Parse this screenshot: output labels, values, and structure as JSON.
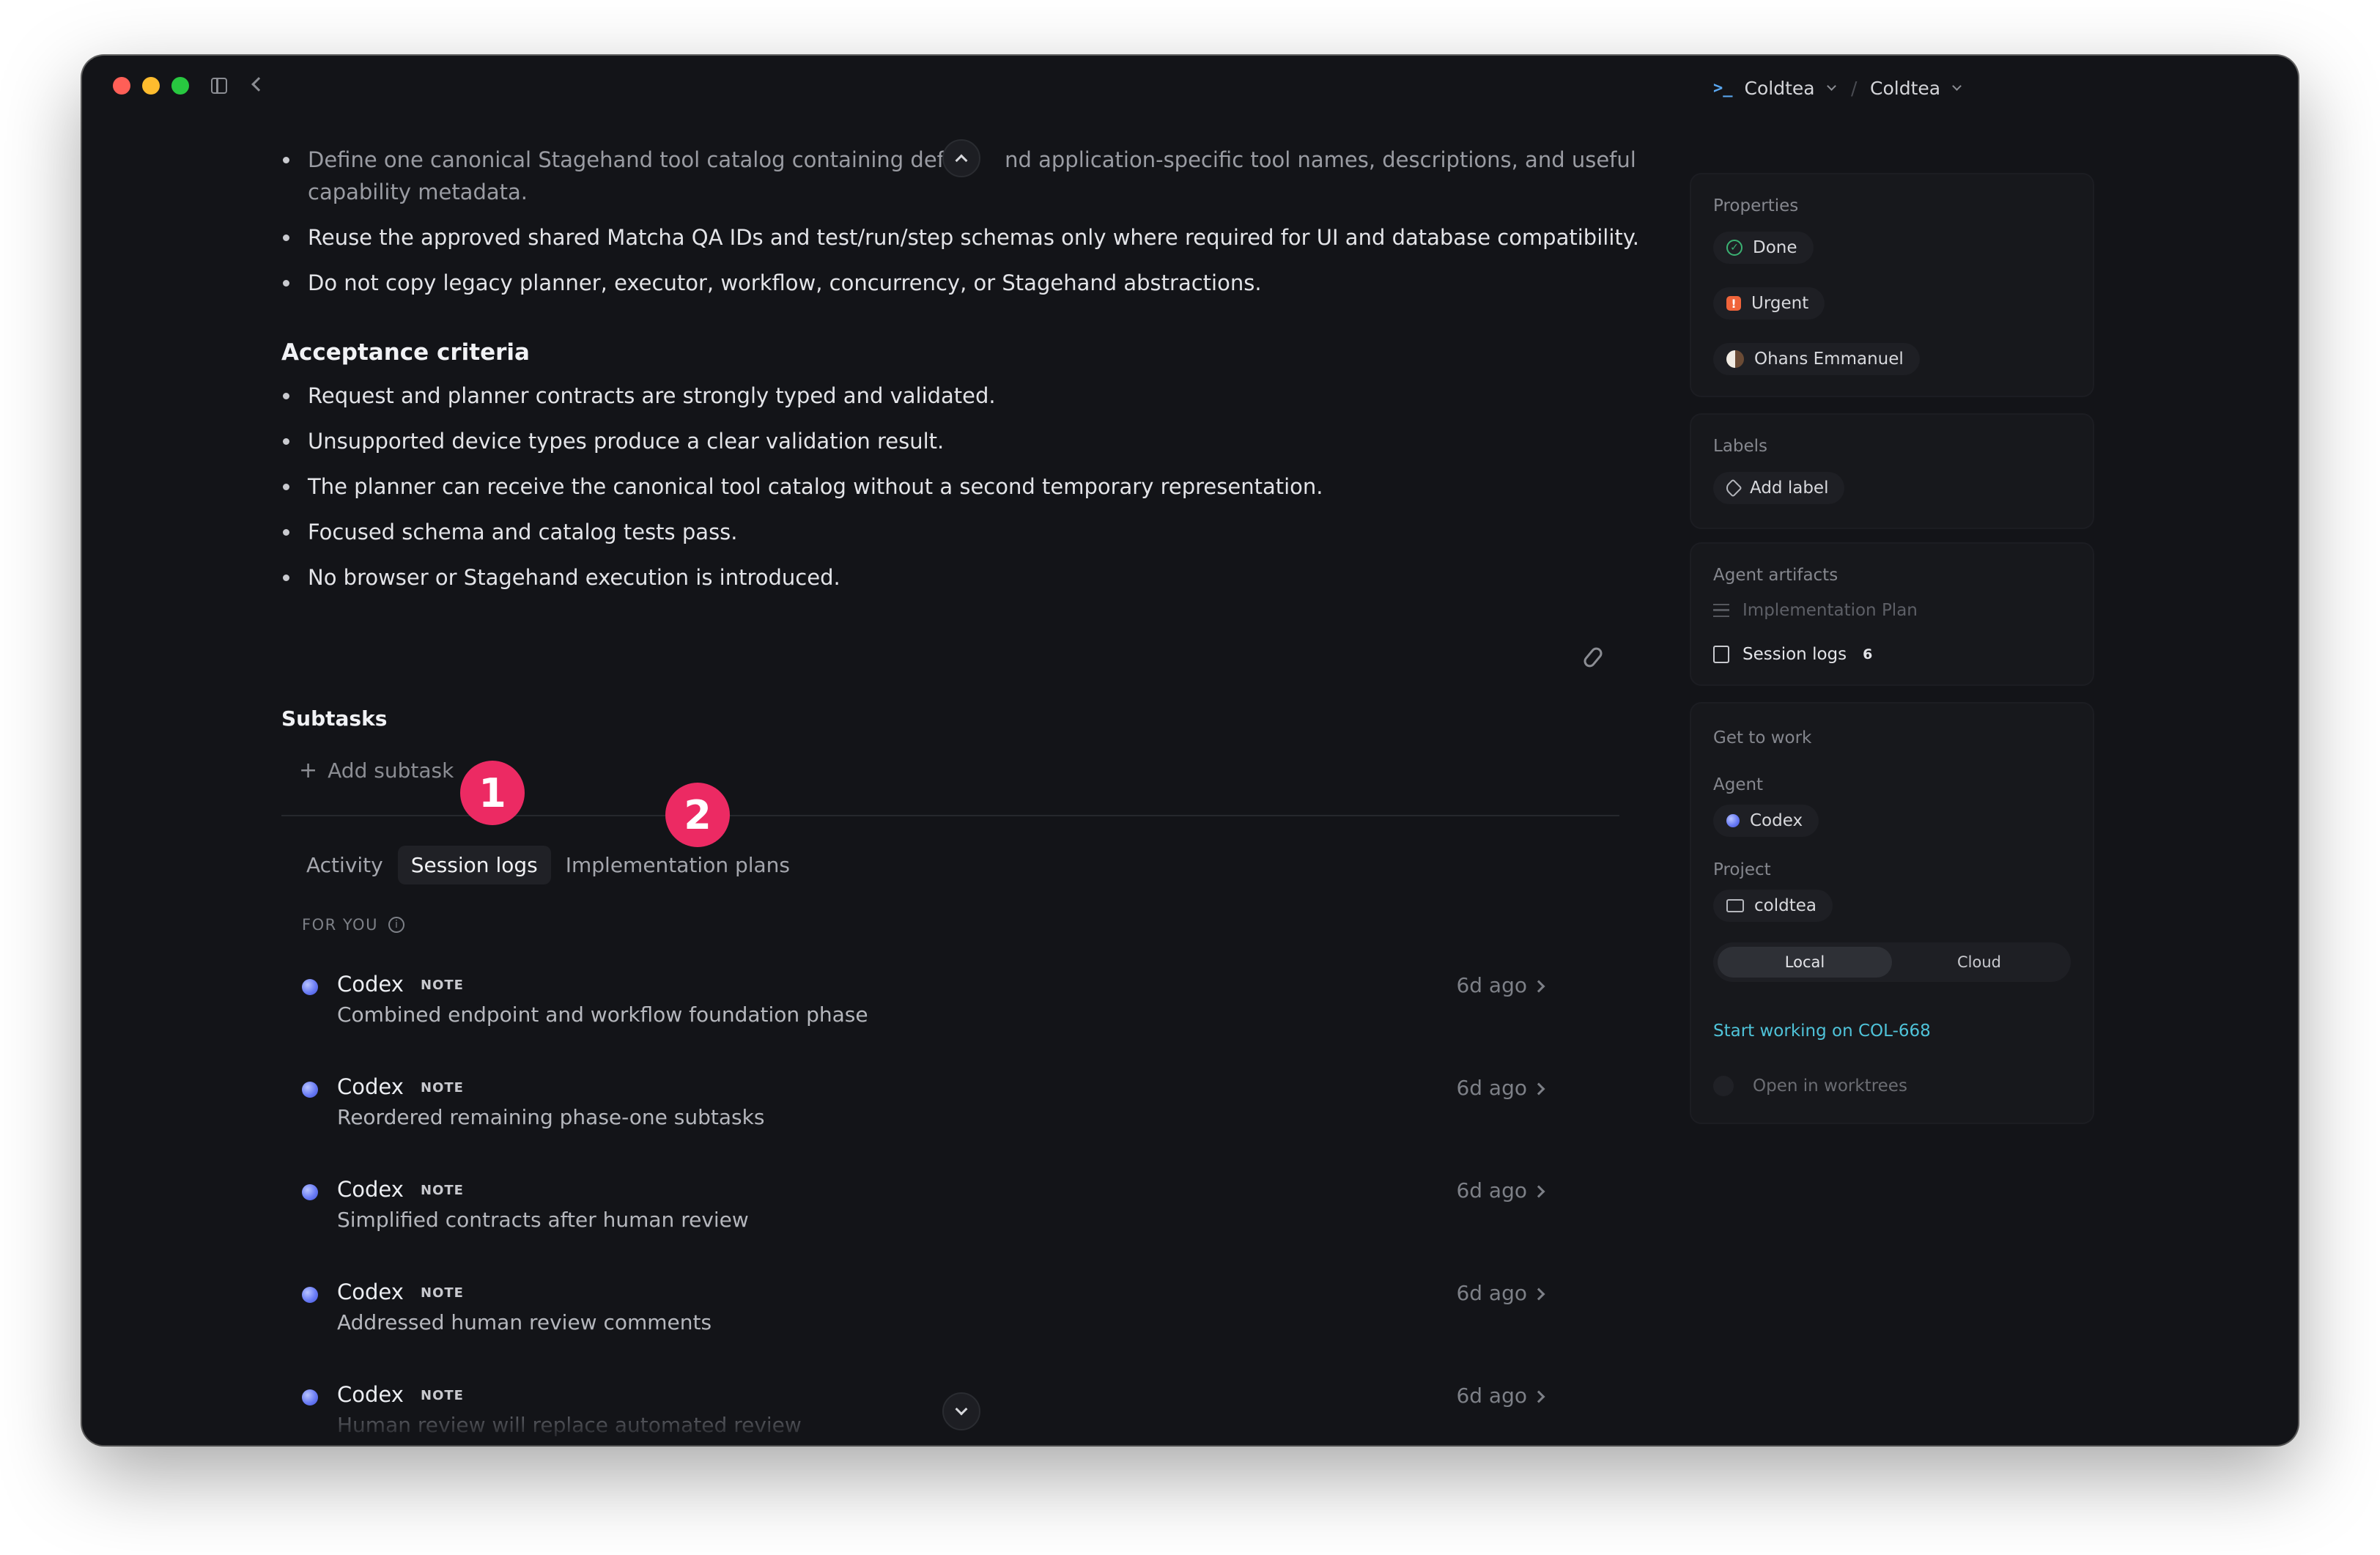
{
  "header": {
    "workspace": "Coldtea",
    "separator": "/",
    "project": "Coldtea"
  },
  "description": {
    "bullets": [
      "Define one canonical Stagehand tool catalog containing defau",
      "nd application-specific tool names, descriptions, and useful capability metadata.",
      "Reuse the approved shared Matcha QA IDs and test/run/step schemas only where required for UI and database compatibility.",
      "Do not copy legacy planner, executor, workflow, concurrency, or Stagehand abstractions."
    ],
    "acceptance_title": "Acceptance criteria",
    "acceptance": [
      "Request and planner contracts are strongly typed and validated.",
      "Unsupported device types produce a clear validation result.",
      "The planner can receive the canonical tool catalog without a second temporary representation.",
      "Focused schema and catalog tests pass.",
      "No browser or Stagehand execution is introduced."
    ]
  },
  "subtasks": {
    "title": "Subtasks",
    "add_label": "Add subtask",
    "add_glyph": "+"
  },
  "annotations": {
    "one": "1",
    "two": "2"
  },
  "tabs": [
    {
      "label": "Activity",
      "active": false
    },
    {
      "label": "Session logs",
      "active": true
    },
    {
      "label": "Implementation plans",
      "active": false
    }
  ],
  "feed": {
    "section_label": "FOR YOU",
    "info_glyph": "i",
    "items": [
      {
        "agent": "Codex",
        "tag": "NOTE",
        "text": "Combined endpoint and workflow foundation phase",
        "time": "6d ago"
      },
      {
        "agent": "Codex",
        "tag": "NOTE",
        "text": "Reordered remaining phase-one subtasks",
        "time": "6d ago"
      },
      {
        "agent": "Codex",
        "tag": "NOTE",
        "text": "Simplified contracts after human review",
        "time": "6d ago"
      },
      {
        "agent": "Codex",
        "tag": "NOTE",
        "text": "Addressed human review comments",
        "time": "6d ago"
      },
      {
        "agent": "Codex",
        "tag": "NOTE",
        "text": "Human review will replace automated review",
        "time": "6d ago"
      }
    ]
  },
  "properties": {
    "title": "Properties",
    "status": "Done",
    "priority": "Urgent",
    "priority_glyph": "!",
    "status_glyph": "✓",
    "assignee": "Ohans Emmanuel"
  },
  "labels": {
    "title": "Labels",
    "add_label": "Add label"
  },
  "artifacts": {
    "title": "Agent artifacts",
    "plan": "Implementation Plan",
    "logs": "Session logs",
    "logs_count": "6"
  },
  "work": {
    "title": "Get to work",
    "agent_label": "Agent",
    "agent": "Codex",
    "project_label": "Project",
    "project": "coldtea",
    "modes": [
      "Local",
      "Cloud"
    ],
    "active_mode": "Local",
    "start_link": "Start working on COL-668",
    "worktrees_label": "Open in worktrees"
  },
  "colors": {
    "accent_link": "#4fc3d9",
    "status_done": "#3bb273",
    "priority_urgent": "#f0643a",
    "annotation_badge": "#ec2a63"
  }
}
